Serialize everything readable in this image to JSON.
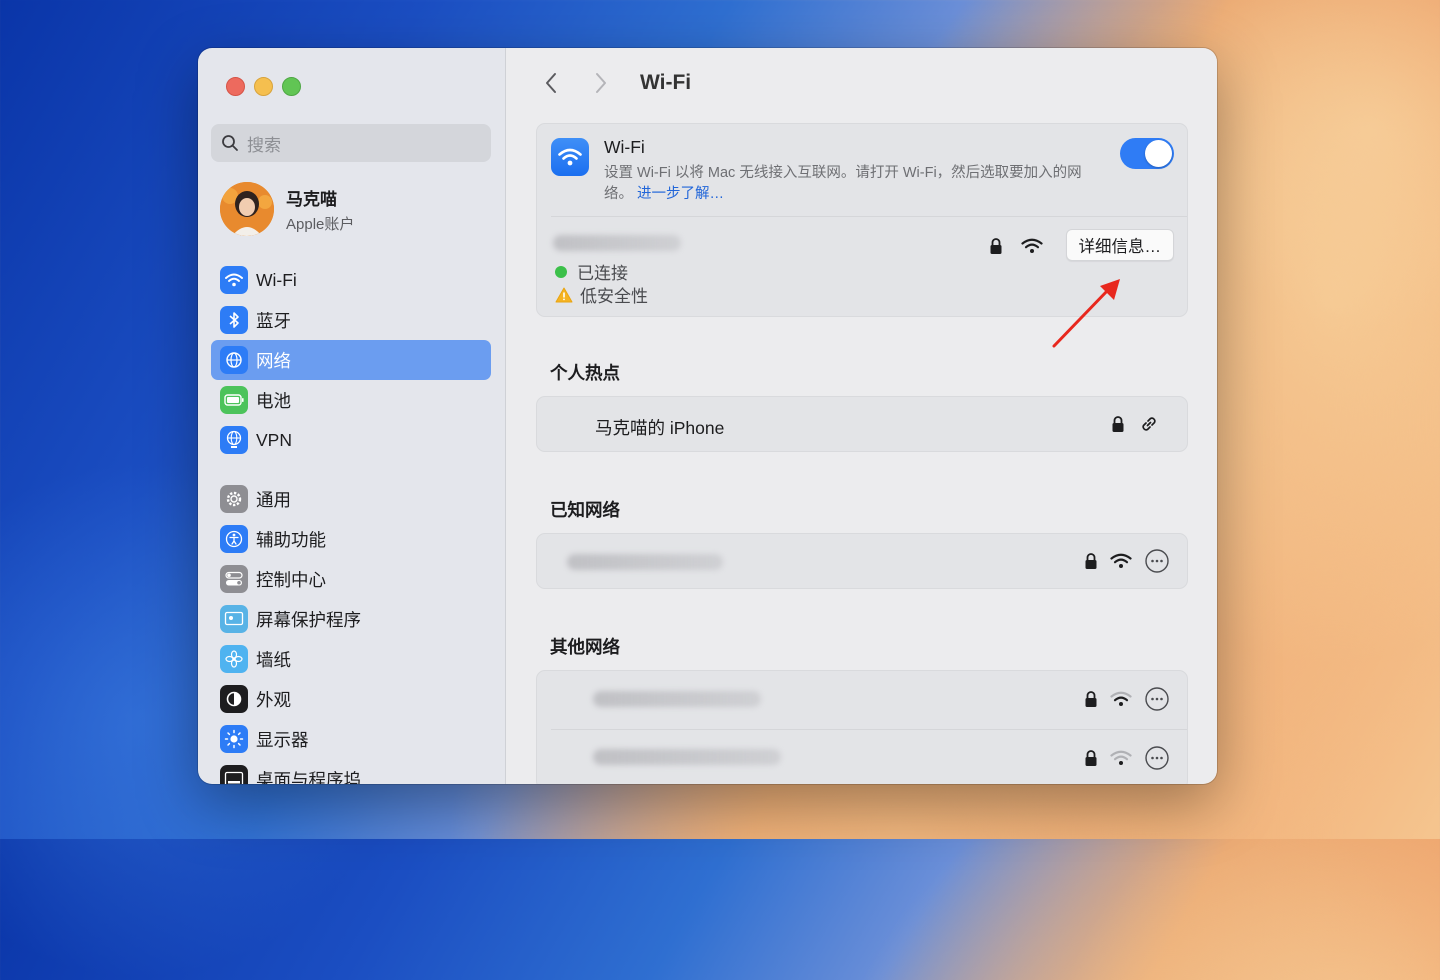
{
  "sidebar": {
    "search_placeholder": "搜索",
    "profile": {
      "name": "马克喵",
      "subtitle": "Apple账户"
    },
    "items_top": [
      {
        "label": "Wi-Fi",
        "icon": "wifi-icon",
        "color": "#2d7cf6"
      },
      {
        "label": "蓝牙",
        "icon": "bluetooth-icon",
        "color": "#2d7cf6"
      },
      {
        "label": "网络",
        "icon": "globe-icon",
        "color": "#2d7cf6",
        "active": true
      },
      {
        "label": "电池",
        "icon": "battery-icon",
        "color": "#4cc35b"
      },
      {
        "label": "VPN",
        "icon": "vpn-globe-icon",
        "color": "#2d7cf6"
      }
    ],
    "items_bottom": [
      {
        "label": "通用",
        "icon": "gear-icon",
        "color": "#8e8e93"
      },
      {
        "label": "辅助功能",
        "icon": "accessibility-icon",
        "color": "#2d7cf6"
      },
      {
        "label": "控制中心",
        "icon": "toggles-icon",
        "color": "#8e8e93"
      },
      {
        "label": "屏幕保护程序",
        "icon": "screensaver-icon",
        "color": "#58b3e6"
      },
      {
        "label": "墙纸",
        "icon": "flower-icon",
        "color": "#4fb3f0"
      },
      {
        "label": "外观",
        "icon": "appearance-icon",
        "color": "#1d1d1f"
      },
      {
        "label": "显示器",
        "icon": "sun-icon",
        "color": "#2d7cf6"
      },
      {
        "label": "桌面与程序坞",
        "icon": "dock-icon",
        "color": "#1d1d1f"
      }
    ]
  },
  "header": {
    "title": "Wi-Fi"
  },
  "wifi_card": {
    "title": "Wi-Fi",
    "description": "设置 Wi-Fi 以将 Mac 无线接入互联网。请打开 Wi-Fi，然后选取要加入的网络。",
    "learn_more": "进一步了解…",
    "toggle_on": true,
    "connected_status": "已连接",
    "security_warning": "低安全性",
    "details_button": "详细信息…"
  },
  "hotspot": {
    "title": "个人热点",
    "device": "马克喵的 iPhone"
  },
  "known_networks": {
    "title": "已知网络"
  },
  "other_networks": {
    "title": "其他网络"
  },
  "colors": {
    "accent": "#2f7cf5",
    "sidebar_active": "#6b9df0",
    "annotation_arrow": "#e8281e"
  }
}
